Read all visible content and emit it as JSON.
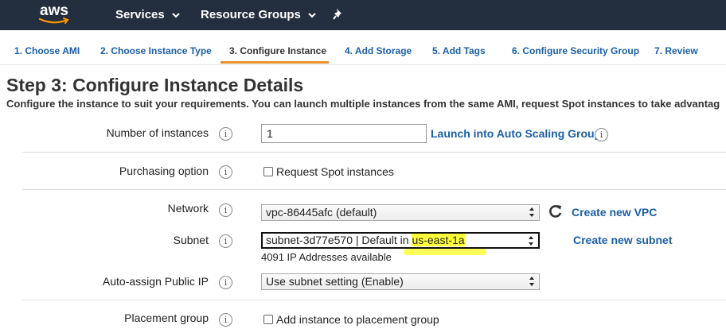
{
  "topbar": {
    "logo_text": "aws",
    "nav": [
      {
        "label": "Services"
      },
      {
        "label": "Resource Groups"
      }
    ],
    "pin_icon": "pin-icon"
  },
  "wizard": {
    "active_step": 3,
    "steps": [
      {
        "label": "1. Choose AMI"
      },
      {
        "label": "2. Choose Instance Type"
      },
      {
        "label": "3. Configure Instance"
      },
      {
        "label": "4. Add Storage"
      },
      {
        "label": "5. Add Tags"
      },
      {
        "label": "6. Configure Security Group"
      },
      {
        "label": "7. Review"
      }
    ],
    "accent_color": "#e7912b",
    "link_color": "#1a5fa8"
  },
  "page": {
    "title": "Step 3: Configure Instance Details",
    "description": "Configure the instance to suit your requirements. You can launch multiple instances from the same AMI, request Spot instances to take advantag"
  },
  "form": {
    "number_of_instances": {
      "label": "Number of instances",
      "value": "1",
      "link": "Launch into Auto Scaling Group"
    },
    "purchasing_option": {
      "label": "Purchasing option",
      "checkbox_label": "Request Spot instances",
      "checked": false
    },
    "network": {
      "label": "Network",
      "selected": "vpc-86445afc (default)",
      "link": "Create new VPC"
    },
    "subnet": {
      "label": "Subnet",
      "selected_prefix": "subnet-3d77e570 | Default in ",
      "selected_highlight": "us-east-1a",
      "note": "4091 IP Addresses available",
      "link": "Create new subnet"
    },
    "auto_assign_ip": {
      "label": "Auto-assign Public IP",
      "selected": "Use subnet setting (Enable)"
    },
    "placement_group": {
      "label": "Placement group",
      "checkbox_label": "Add instance to placement group",
      "checked": false
    },
    "info_glyph": "i"
  }
}
